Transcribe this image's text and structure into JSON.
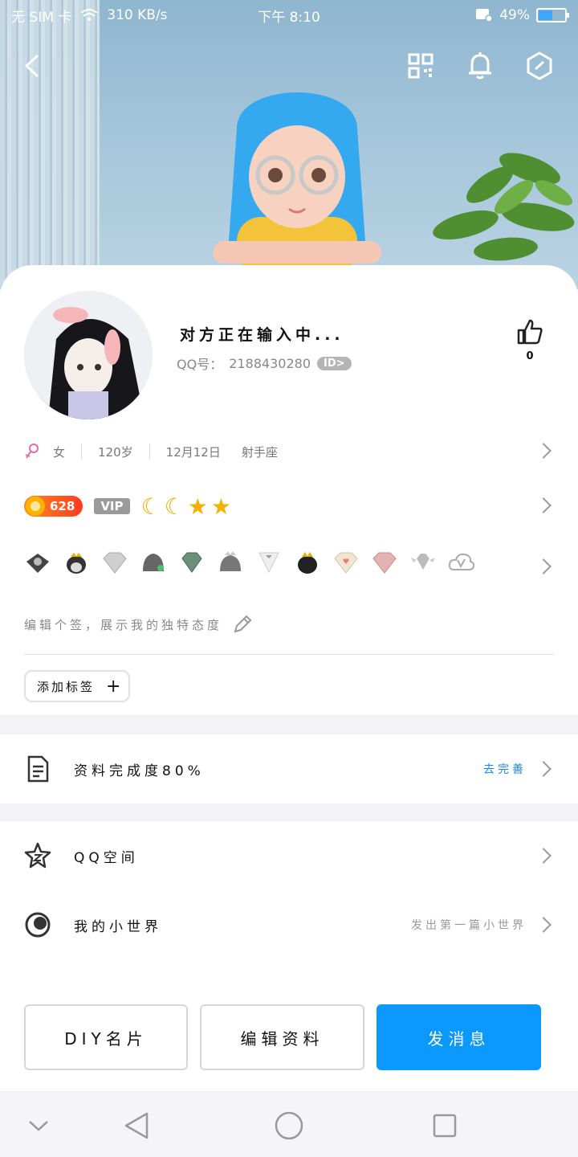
{
  "status_bar": {
    "sim_text": "无 SIM 卡",
    "speed": "310 KB/s",
    "time": "下午 8:10",
    "battery": "49%",
    "battery_level": 0.49
  },
  "profile": {
    "nickname": "对方正在输入中...",
    "qq_label": "QQ号：",
    "qq_number": "2188430280",
    "id_badge": "ID>",
    "likes": "0"
  },
  "info": {
    "gender": "女",
    "age": "120岁",
    "birthday": "12月12日",
    "zodiac": "射手座"
  },
  "vip": {
    "coin_value": "628",
    "vip_label": "VIP"
  },
  "signature_placeholder": "编辑个签，展示我的独特态度",
  "add_tag_label": "添加标签",
  "list": {
    "completion_label": "资料完成度80%",
    "completion_action": "去完善",
    "qzone_label": "QQ空间",
    "myworld_label": "我的小世界",
    "myworld_hint": "发出第一篇小世界"
  },
  "buttons": {
    "diy": "DIY名片",
    "edit": "编辑资料",
    "message": "发消息"
  },
  "colors": {
    "primary": "#0b99ff",
    "link": "#1a86f5",
    "gender": "#e26aa8"
  }
}
